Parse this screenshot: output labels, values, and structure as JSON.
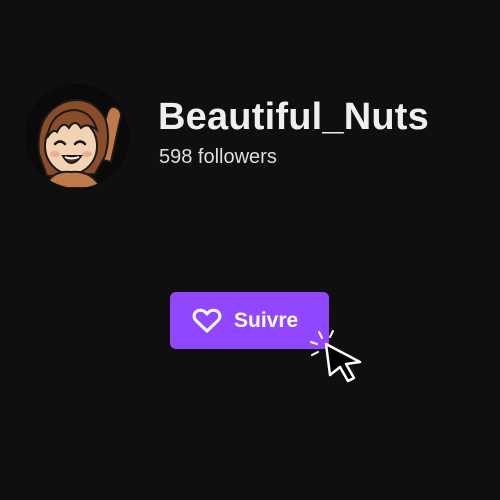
{
  "channel": {
    "username": "Beautiful_Nuts",
    "followers_text": "598 followers",
    "avatar_icon": "cartoon-avatar"
  },
  "follow_button": {
    "label": "Suivre",
    "icon": "heart-outline-icon",
    "color": "#9147ff"
  },
  "cursor": {
    "icon": "mouse-pointer-click-icon"
  },
  "colors": {
    "background": "#0f0f10",
    "text": "#efeff1",
    "accent": "#9147ff"
  }
}
